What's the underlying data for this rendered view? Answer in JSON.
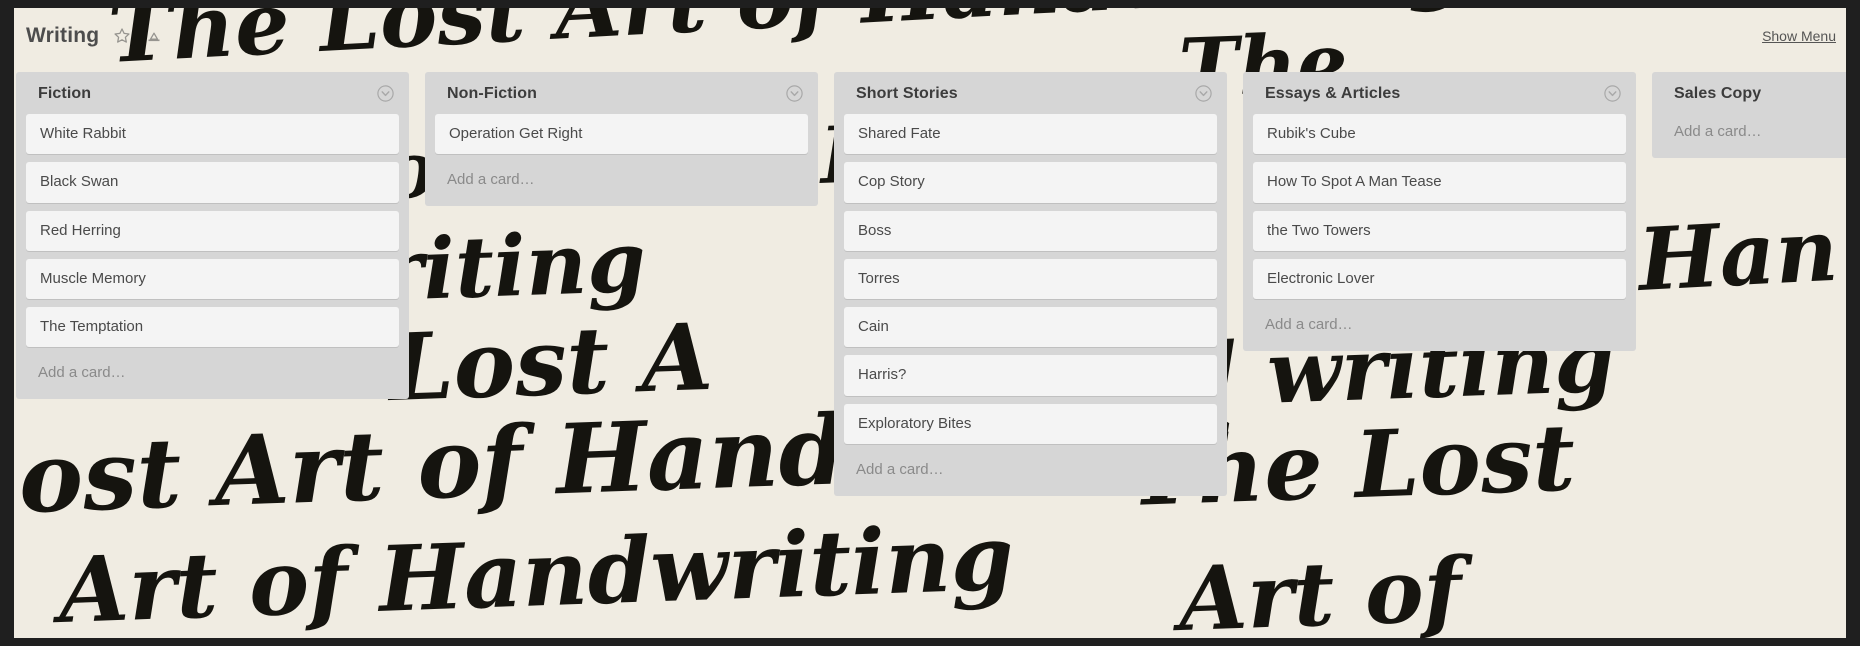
{
  "header": {
    "board_title": "Writing",
    "star_icon": "star-icon",
    "subscribe_icon": "subscribe-icon",
    "show_menu_label": "Show Menu"
  },
  "theme": {
    "board_background": "#f0ece2",
    "list_background": "#d6d6d6",
    "card_background": "#f4f4f4",
    "text_color": "#4a4a4a",
    "muted_text_color": "#8a8a8a"
  },
  "background_text": "The Lost Art of Handwriting",
  "lists": [
    {
      "title": "Fiction",
      "menu_icon": "chevron-down-circle-icon",
      "add_card_label": "Add a card…",
      "cards": [
        "White Rabbit",
        "Black Swan",
        "Red Herring",
        "Muscle Memory",
        "The Temptation"
      ]
    },
    {
      "title": "Non-Fiction",
      "menu_icon": "chevron-down-circle-icon",
      "add_card_label": "Add a card…",
      "cards": [
        "Operation Get Right"
      ]
    },
    {
      "title": "Short Stories",
      "menu_icon": "chevron-down-circle-icon",
      "add_card_label": "Add a card…",
      "cards": [
        "Shared Fate",
        "Cop Story",
        "Boss",
        "Torres",
        "Cain",
        "Harris?",
        "Exploratory Bites"
      ]
    },
    {
      "title": "Essays & Articles",
      "menu_icon": "chevron-down-circle-icon",
      "add_card_label": "Add a card…",
      "cards": [
        "Rubik's Cube",
        "How To Spot A Man Tease",
        "the Two Towers",
        "Electronic Lover"
      ]
    },
    {
      "title": "Sales Copy",
      "menu_icon": "chevron-down-circle-icon",
      "add_card_label": "Add a card…",
      "cards": []
    }
  ]
}
